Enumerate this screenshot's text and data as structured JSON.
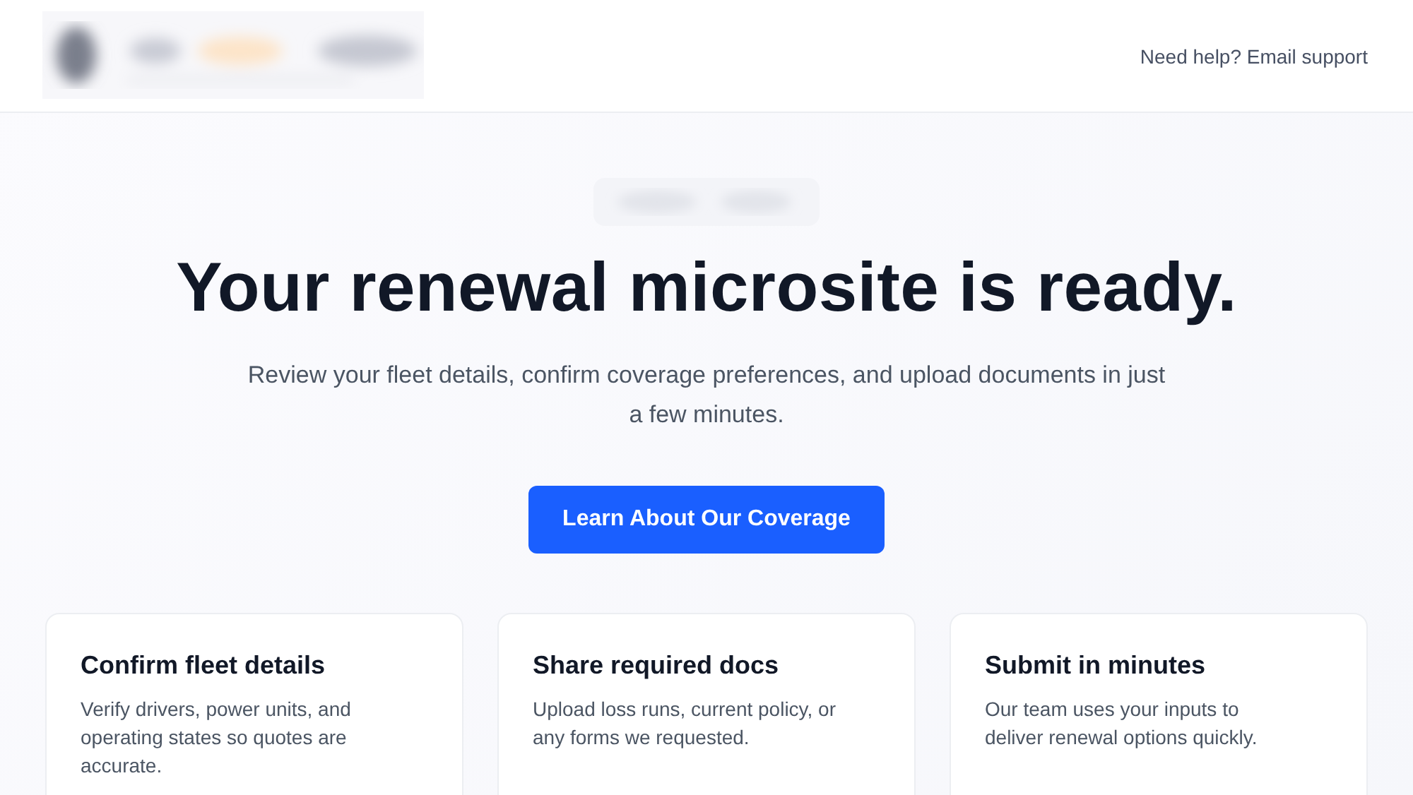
{
  "header": {
    "help_link": "Need help? Email support"
  },
  "hero": {
    "title": "Your renewal microsite is ready.",
    "subtitle": "Review your fleet details, confirm coverage preferences, and upload documents in just a few minutes.",
    "cta": "Learn About Our Coverage"
  },
  "cards": [
    {
      "title": "Confirm fleet details",
      "text": "Verify drivers, power units, and operating states so quotes are accurate."
    },
    {
      "title": "Share required docs",
      "text": "Upload loss runs, current policy, or any forms we requested."
    },
    {
      "title": "Submit in minutes",
      "text": "Our team uses your inputs to deliver renewal options quickly."
    }
  ]
}
